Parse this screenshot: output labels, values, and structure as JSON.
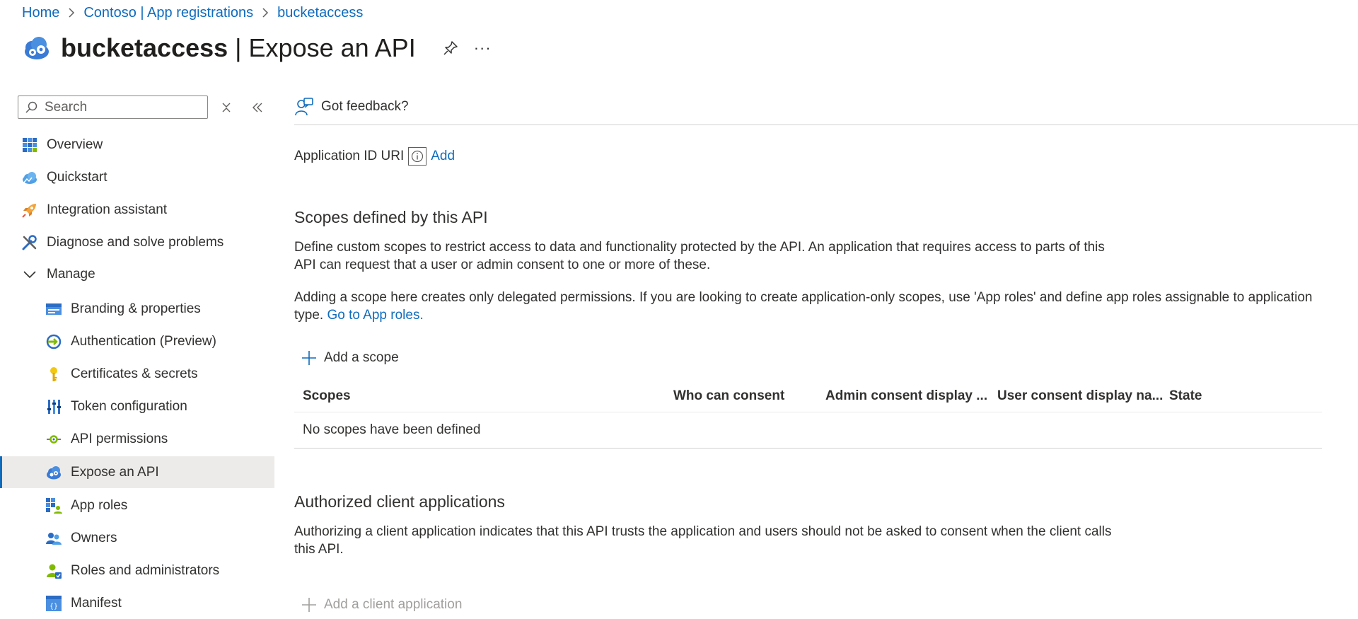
{
  "breadcrumb": [
    {
      "label": "Home"
    },
    {
      "label": "Contoso | App registrations"
    },
    {
      "label": "bucketaccess"
    }
  ],
  "header": {
    "app_name": "bucketaccess",
    "separator": " | ",
    "page_name": "Expose an API",
    "more_label": "···"
  },
  "sidebar": {
    "search_placeholder": "Search",
    "items": [
      {
        "label": "Overview",
        "icon": "overview-grid-icon"
      },
      {
        "label": "Quickstart",
        "icon": "quickstart-cloud-icon"
      },
      {
        "label": "Integration assistant",
        "icon": "rocket-icon"
      },
      {
        "label": "Diagnose and solve problems",
        "icon": "wrench-icon"
      },
      {
        "label": "Manage",
        "icon": "chevron-down-icon"
      },
      {
        "label": "Branding & properties",
        "icon": "branding-icon"
      },
      {
        "label": "Authentication (Preview)",
        "icon": "authentication-icon"
      },
      {
        "label": "Certificates & secrets",
        "icon": "key-icon"
      },
      {
        "label": "Token configuration",
        "icon": "token-bars-icon"
      },
      {
        "label": "API permissions",
        "icon": "api-permissions-icon"
      },
      {
        "label": "Expose an API",
        "icon": "cloud-gear-icon",
        "selected": true
      },
      {
        "label": "App roles",
        "icon": "app-roles-icon"
      },
      {
        "label": "Owners",
        "icon": "owners-icon"
      },
      {
        "label": "Roles and administrators",
        "icon": "roles-admin-icon"
      },
      {
        "label": "Manifest",
        "icon": "manifest-icon"
      }
    ]
  },
  "toolbar": {
    "feedback_label": "Got feedback?"
  },
  "app_id": {
    "label": "Application ID URI",
    "add_label": "Add"
  },
  "scopes": {
    "title": "Scopes defined by this API",
    "desc1_line1": "Define custom scopes to restrict access to data and functionality protected by the API. An application that requires access to parts of this",
    "desc1_line2": "API can request that a user or admin consent to one or more of these.",
    "desc2_line1": "Adding a scope here creates only delegated permissions. If you are looking to create application-only scopes, use 'App roles' and define app roles assignable to application",
    "desc2_prefix": "type.",
    "desc2_link": "Go to App roles.",
    "add_label": "Add a scope",
    "columns": [
      "Scopes",
      "Who can consent",
      "Admin consent display ...",
      "User consent display na...",
      "State"
    ],
    "empty_text": "No scopes have been defined"
  },
  "authorized": {
    "title": "Authorized client applications",
    "desc_line1": "Authorizing a client application indicates that this API trusts the application and users should not be asked to consent when the client calls",
    "desc_line2": "this API.",
    "add_label": "Add a client application"
  },
  "colors": {
    "accent": "#0f6cbd",
    "selected_bg": "#edebe9",
    "text": "#323130"
  }
}
